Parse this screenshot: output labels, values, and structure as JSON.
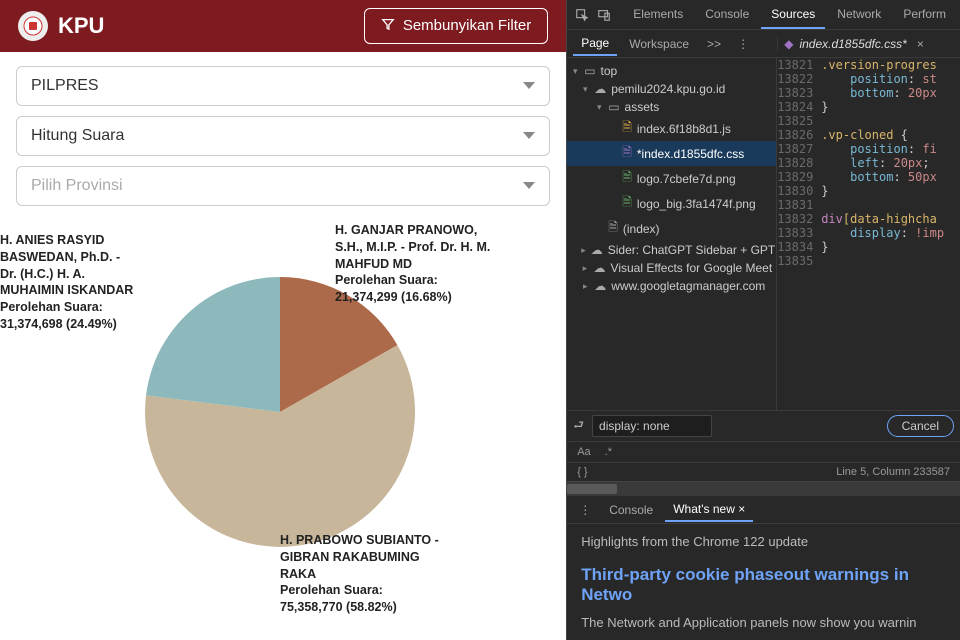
{
  "app": {
    "title": "KPU",
    "logo_text": "⬤",
    "filter_button": "Sembunyikan Filter",
    "selects": {
      "election": "PILPRES",
      "count": "Hitung Suara",
      "province_placeholder": "Pilih Provinsi"
    }
  },
  "chart_data": {
    "type": "pie",
    "title": "",
    "series": [
      {
        "name": "H. ANIES RASYID BASWEDAN, Ph.D. - Dr. (H.C.) H. A. MUHAIMIN ISKANDAR",
        "metric": "Perolehan Suara:",
        "value": 31374698,
        "display": "31,374,698 (24.49%)",
        "pct": 24.49,
        "color": "#8db9bc"
      },
      {
        "name": "H. PRABOWO SUBIANTO - GIBRAN RAKABUMING RAKA",
        "metric": "Perolehan Suara:",
        "value": 75358770,
        "display": "75,358,770 (58.82%)",
        "pct": 58.82,
        "color": "#c7b699"
      },
      {
        "name": "H. GANJAR PRANOWO, S.H., M.I.P. - Prof. Dr. H. M. MAHFUD MD",
        "metric": "Perolehan Suara:",
        "value": 21374299,
        "display": "21,374,299 (16.68%)",
        "pct": 16.68,
        "color": "#ad6a4b"
      }
    ]
  },
  "devtools": {
    "main_tabs": {
      "elements": "Elements",
      "console": "Console",
      "sources": "Sources",
      "network": "Network",
      "performance": "Perform"
    },
    "page_tab": "Page",
    "workspace_tab": "Workspace",
    "more": ">>",
    "open_file": "index.d1855dfc.css*",
    "tree": {
      "top": "top",
      "domain": "pemilu2024.kpu.go.id",
      "assets": "assets",
      "js": "index.6f18b8d1.js",
      "css": "*index.d1855dfc.css",
      "img1": "logo.7cbefe7d.png",
      "img2": "logo_big.3fa1474f.png",
      "index": "(index)",
      "ext1": "Sider: ChatGPT Sidebar + GPT",
      "ext2": "Visual Effects for Google Meet",
      "ext3": "www.googletagmanager.com"
    },
    "code": {
      "l1": {
        "n": "13821",
        "sel": ".version-progres",
        "rest": ""
      },
      "l2": {
        "n": "13822",
        "prop": "position",
        "val": "st"
      },
      "l3": {
        "n": "13823",
        "prop": "bottom",
        "val": "20px"
      },
      "l4": {
        "n": "13824",
        "brace": "}"
      },
      "l5": {
        "n": "13825",
        "blank": ""
      },
      "l6": {
        "n": "13826",
        "sel": ".vp-cloned",
        "open": " {"
      },
      "l7": {
        "n": "13827",
        "prop": "position",
        "val": "fi"
      },
      "l8": {
        "n": "13828",
        "prop": "left",
        "val": "20px",
        "semi": ";"
      },
      "l9": {
        "n": "13829",
        "prop": "bottom",
        "val": "50px"
      },
      "l10": {
        "n": "13830",
        "brace": "}"
      },
      "l11": {
        "n": "13831",
        "blank": ""
      },
      "l12": {
        "n": "13832",
        "seltag": "div",
        "attr": "[data-highcha"
      },
      "l13": {
        "n": "13833",
        "prop": "display",
        "val": "!imp"
      },
      "l14": {
        "n": "13834",
        "brace": "}"
      },
      "l15": {
        "n": "13835",
        "blank": ""
      }
    },
    "search": {
      "value": "display: none",
      "aa": "Aa",
      "regex": ".*",
      "cancel": "Cancel",
      "replace_icon": "↵",
      "bracket_icon": "{ }"
    },
    "status": "Line 5, Column 233587",
    "drawer": {
      "console": "Console",
      "whatsnew": "What's new",
      "highlights": "Highlights from the Chrome 122 update",
      "headline": "Third-party cookie phaseout warnings in Netwo",
      "body": "The Network and Application panels now show you warnin"
    }
  }
}
